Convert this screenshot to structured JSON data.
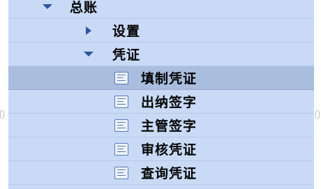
{
  "tree": {
    "root": {
      "label": "总账",
      "expanded": true
    },
    "children": [
      {
        "label": "设置",
        "expanded": false
      },
      {
        "label": "凭证",
        "expanded": true
      }
    ],
    "leaves": [
      {
        "label": "填制凭证",
        "icon": "document-icon",
        "selected": true
      },
      {
        "label": "出纳签字",
        "icon": "document-icon",
        "selected": false
      },
      {
        "label": "主管签字",
        "icon": "document-icon",
        "selected": false
      },
      {
        "label": "审核凭证",
        "icon": "document-icon",
        "selected": false
      },
      {
        "label": "查询凭证",
        "icon": "document-icon",
        "selected": false
      }
    ]
  },
  "colors": {
    "panel_bg": "#c9daf6",
    "selected_bg": "#a9bddf",
    "arrow": "#2b56a3"
  }
}
